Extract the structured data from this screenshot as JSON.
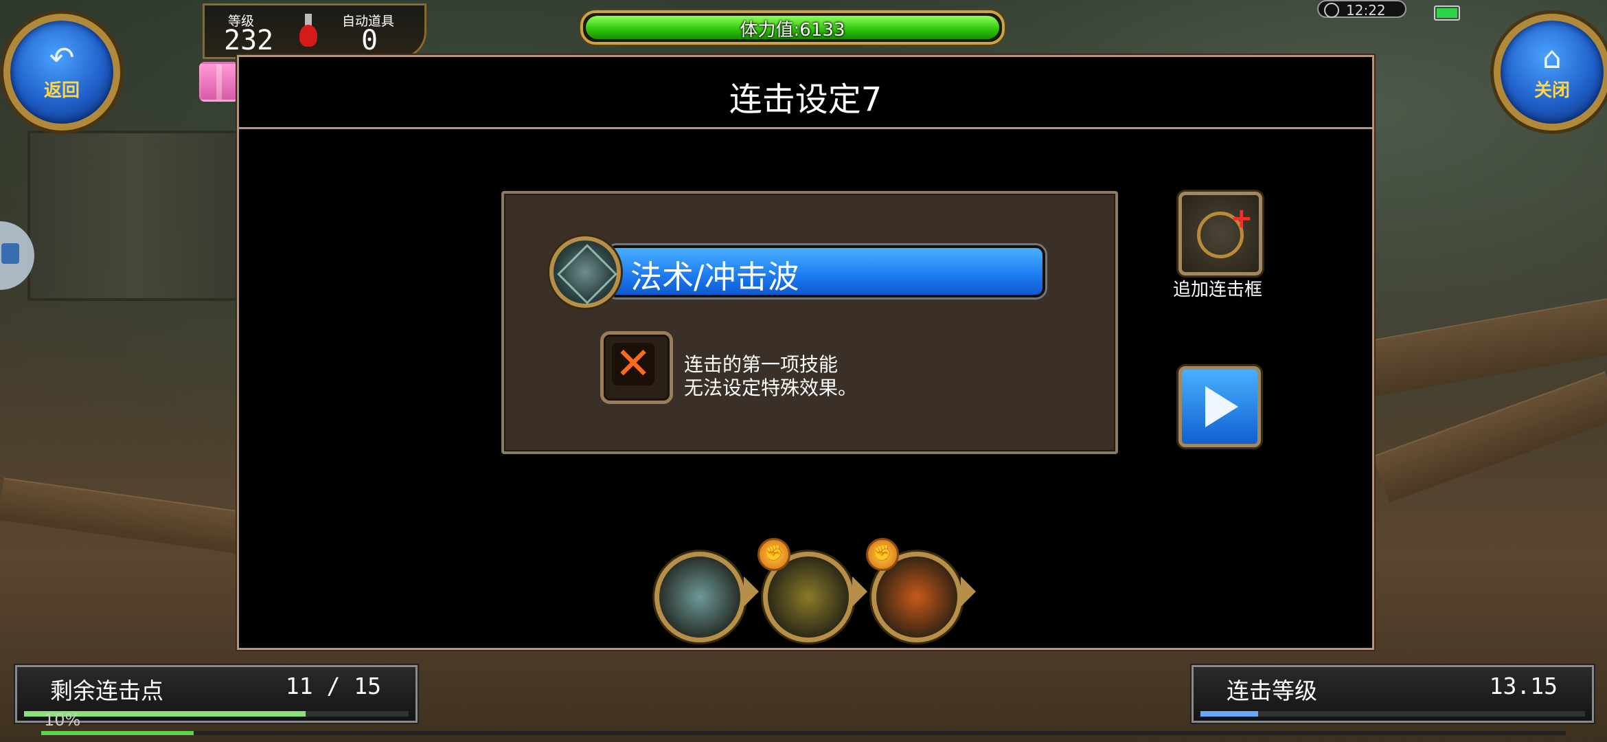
{
  "hud": {
    "back_label": "返回",
    "close_label": "关闭",
    "level_label": "等级",
    "level_value": "232",
    "auto_item_label": "自动道具",
    "auto_item_value": "0",
    "stamina_text": "体力值:6133",
    "stamina_fraction": 1.0,
    "clock": "12:22",
    "xp_text": "10%",
    "xp_fraction": 0.1
  },
  "dialog": {
    "title": "连击设定7",
    "selected_skill": "法术/冲击波",
    "note_line1": "连击的第一项技能",
    "note_line2": "无法设定特殊效果。",
    "add_frame_label": "追加连击框"
  },
  "chain": [
    {
      "name": "shockwave-skill-icon",
      "color": "#6e9a9a",
      "has_fist": false
    },
    {
      "name": "lightning-scroll-skill-icon",
      "color": "#8a7a2a",
      "has_fist": true
    },
    {
      "name": "fire-dome-skill-icon",
      "color": "#c85a1a",
      "has_fist": true
    }
  ],
  "bottom": {
    "remaining_label": "剩余连击点",
    "remaining_value": "11 / 15",
    "remaining_fraction": 0.733,
    "combo_level_label": "连击等级",
    "combo_level_value": "13.15",
    "combo_level_fraction": 0.15
  },
  "colors": {
    "accent_blue": "#1b7af0",
    "stamina_green": "#2ec40a",
    "gold_frame": "#b69048"
  }
}
